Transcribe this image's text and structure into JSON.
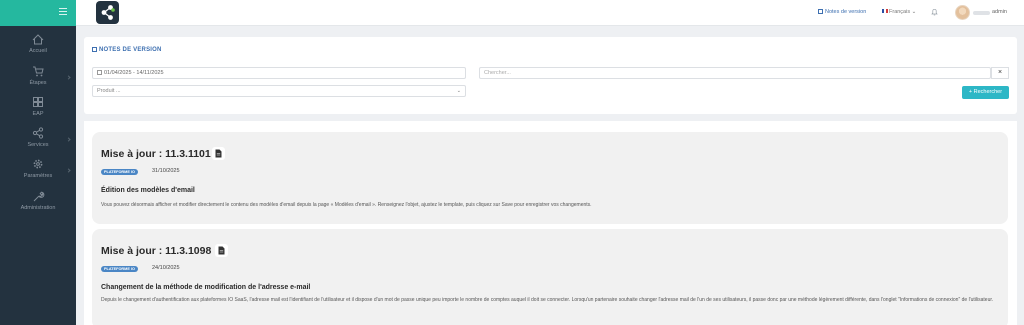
{
  "sidebar": {
    "items": [
      {
        "label": "Accueil",
        "icon": "home-icon"
      },
      {
        "label": "Étapes",
        "icon": "cart-icon"
      },
      {
        "label": "EAP",
        "icon": "grid-icon"
      },
      {
        "label": "Services",
        "icon": "share-icon"
      },
      {
        "label": "Paramètres",
        "icon": "gear-icon"
      },
      {
        "label": "Administration",
        "icon": "wrench-icon"
      }
    ]
  },
  "topbar": {
    "release_notes_label": "Notes de version",
    "language_label": "Français",
    "user_name": "admin"
  },
  "filters": {
    "section_title": "NOTES DE VERSION",
    "date_range": "01/04/2025 - 14/11/2025",
    "search_placeholder": "Chercher...",
    "clear_label": "×",
    "product_placeholder": "Produit ...",
    "search_button_label": "+ Rechercher"
  },
  "updates": [
    {
      "title": "Mise à jour : 11.3.1101",
      "badge": "PLATEFORME IO",
      "date": "31/10/2025",
      "heading": "Édition des modèles d'email",
      "description": "Vous pouvez désormais afficher et modifier directement le contenu des modèles d'email depuis la page « Modèles d'email ». Renseignez l'objet, ajustez le template, puis cliquez sur Save pour enregistrer vos changements."
    },
    {
      "title": "Mise à jour : 11.3.1098",
      "badge": "PLATEFORME IO",
      "date": "24/10/2025",
      "heading": "Changement de la méthode de modification de l'adresse e-mail",
      "description": "Depuis le changement d'authentification aux plateformes IO SaaS, l'adresse mail est l'identifiant de l'utilisateur et il dispose d'un mot de passe unique peu importe le nombre de comptes auquel il doit se connecter. Lorsqu'un partenaire souhaite changer l'adresse mail de l'un de ses utilisateurs, il passe donc par une méthode légèrement différente, dans l'onglet \"Informations de connexion\" de l'utilisateur."
    }
  ]
}
